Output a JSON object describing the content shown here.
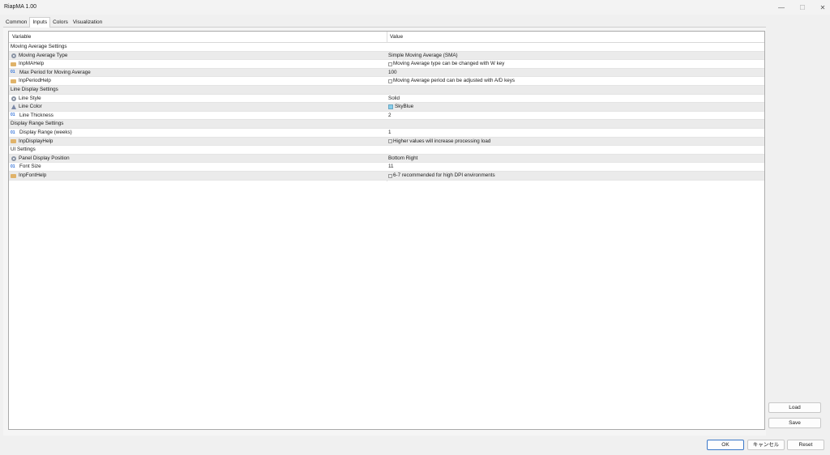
{
  "window": {
    "title": "RiapMA 1.00",
    "minimize_glyph": "—",
    "maximize_glyph": "☐",
    "close_glyph": "✕"
  },
  "tabs": [
    {
      "label": "Common",
      "active": false
    },
    {
      "label": "Inputs",
      "active": true
    },
    {
      "label": "Colors",
      "active": false
    },
    {
      "label": "Visualization",
      "active": false
    }
  ],
  "grid": {
    "headers": {
      "variable": "Variable",
      "value": "Value"
    },
    "rows": [
      {
        "kind": "group",
        "variable": "Moving Average Settings",
        "value": ""
      },
      {
        "kind": "enum",
        "icon": "enum-icon",
        "variable": "Moving Average Type",
        "value": "Simple Moving Average (SMA)"
      },
      {
        "kind": "string",
        "icon": "string-icon",
        "variable": "InpMAHelp",
        "value": "Moving Average type can be changed with W key"
      },
      {
        "kind": "int",
        "icon": "integer-icon",
        "variable": "Max Period for Moving Average",
        "value": "100"
      },
      {
        "kind": "string",
        "icon": "string-icon",
        "variable": "InpPeriodHelp",
        "value": "Moving Average period can be adjusted with A/D keys"
      },
      {
        "kind": "group",
        "variable": "Line Display Settings",
        "value": ""
      },
      {
        "kind": "enum",
        "icon": "enum-icon",
        "variable": "Line Style",
        "value": "Solid"
      },
      {
        "kind": "color",
        "icon": "color-icon",
        "variable": "Line Color",
        "value": "SkyBlue"
      },
      {
        "kind": "int",
        "icon": "integer-icon",
        "variable": "Line Thickness",
        "value": "2"
      },
      {
        "kind": "group",
        "variable": "Display Range Settings",
        "value": ""
      },
      {
        "kind": "int",
        "icon": "integer-icon",
        "variable": "Display Range (weeks)",
        "value": "1"
      },
      {
        "kind": "string",
        "icon": "string-icon",
        "variable": "InpDisplayHelp",
        "value": "Higher values will increase processing load"
      },
      {
        "kind": "group",
        "variable": "UI Settings",
        "value": ""
      },
      {
        "kind": "enum",
        "icon": "enum-icon",
        "variable": "Panel Display Position",
        "value": "Bottom Right"
      },
      {
        "kind": "int",
        "icon": "integer-icon",
        "variable": "Font Size",
        "value": "11"
      },
      {
        "kind": "string",
        "icon": "string-icon",
        "variable": "InpFontHelp",
        "value": "6-7 recommended for high DPI environments"
      }
    ]
  },
  "side_buttons": {
    "load": "Load",
    "save": "Save"
  },
  "footer_buttons": {
    "ok": "OK",
    "cancel": "キャンセル",
    "reset": "Reset"
  },
  "colors": {
    "line_color_swatch": "#87CEEB",
    "ok_border": "#3B78C8"
  },
  "icon_glyphs": {
    "integer": "01"
  }
}
